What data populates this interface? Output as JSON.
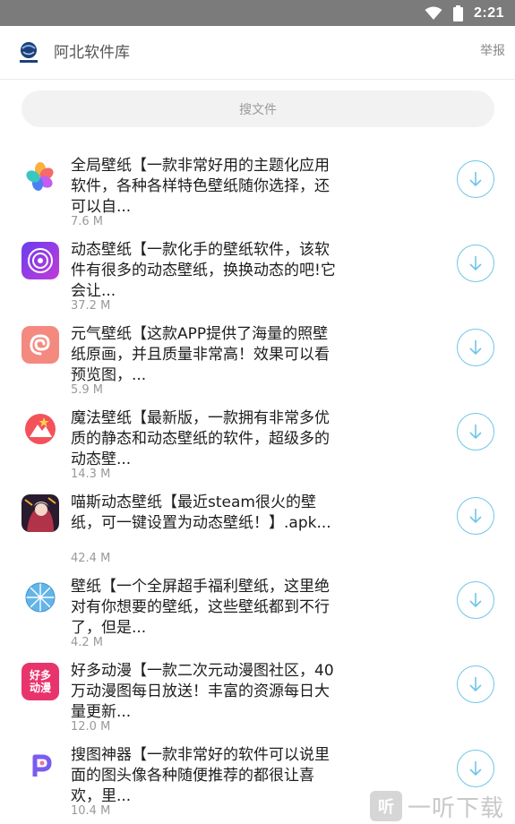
{
  "status": {
    "time": "2:21"
  },
  "appbar": {
    "title": "阿北软件库",
    "report": "举报"
  },
  "search": {
    "placeholder": "搜文件"
  },
  "items": [
    {
      "text": "全局壁纸【一款非常好用的主题化应用软件，各种各样特色壁纸随你选择，还可以自...",
      "size": "7.6 M",
      "icon": "petal-flower-icon"
    },
    {
      "text": "动态壁纸【一款化手的壁纸软件，该软件有很多的动态壁纸，换换动态的吧!它会让...",
      "size": "37.2 M",
      "icon": "concentric-circle-icon"
    },
    {
      "text": "元气壁纸【这款APP提供了海量的照壁纸原画，并且质量非常高！效果可以看预览图，...",
      "size": "5.9 M",
      "icon": "swirl-icon"
    },
    {
      "text": "魔法壁纸【最新版，一款拥有非常多优质的静态和动态壁纸的软件，超级多的动态壁...",
      "size": "14.3 M",
      "icon": "mountain-star-icon"
    },
    {
      "text": "喵斯动态壁纸【最近steam很火的壁纸，可一键设置为动态壁纸！】.apk...",
      "size": "42.4 M",
      "icon": "anime-character-icon"
    },
    {
      "text": "壁纸【一个全屏超手福利壁纸，这里绝对有你想要的壁纸，这些壁纸都到不行了，但是...",
      "size": "4.2 M",
      "icon": "umbrella-icon"
    },
    {
      "text": "好多动漫【一款二次元动漫图社区，40万动漫图每日放送！丰富的资源每日大量更新...",
      "size": "12.0 M",
      "icon": "haoduo-dongman-icon",
      "icon_text": [
        "好多",
        "动漫"
      ]
    },
    {
      "text": "搜图神器【一款非常好的软件可以说里面的图头像各种随便推荐的都很让喜欢，里...",
      "size": "10.4 M",
      "icon": "p-letter-icon"
    }
  ],
  "watermark": {
    "text": "一听下载",
    "badge": "听"
  },
  "colors": {
    "status_bar": "#7b7b7b",
    "download_accent": "#6fc6e8",
    "search_bg": "#f2f2f2"
  }
}
